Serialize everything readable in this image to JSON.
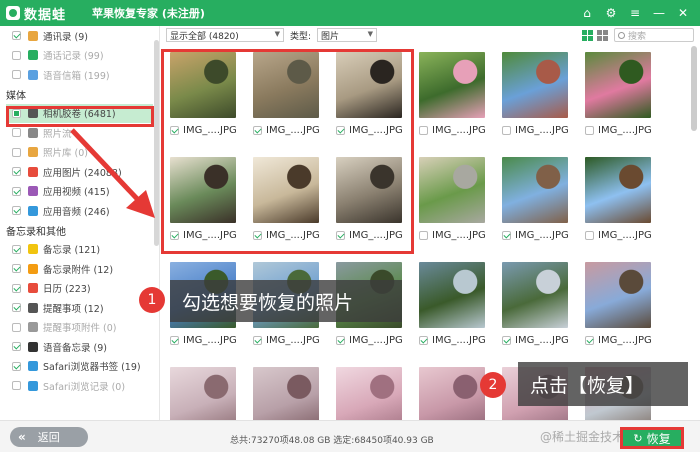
{
  "app": {
    "logo_text": "数据蛙",
    "title": "苹果恢复专家 (未注册)",
    "window_controls": [
      "home-icon",
      "gear-icon",
      "menu-icon",
      "minimize-icon",
      "close-icon"
    ]
  },
  "sidebar": {
    "top_items": [
      {
        "label": "通讯录 (9)",
        "checked": true,
        "icon_color": "#e8a640"
      },
      {
        "label": "通话记录 (99)",
        "checked": false,
        "icon_color": "#27ae60",
        "dim": true
      },
      {
        "label": "语音信箱 (199)",
        "checked": false,
        "icon_color": "#5aa0e0",
        "dim": true
      }
    ],
    "media_section": "媒体",
    "media_items": [
      {
        "label": "相机胶卷 (6481)",
        "checked": "partial",
        "icon_color": "#555",
        "selected": true
      },
      {
        "label": "照片流",
        "checked": false,
        "icon_color": "#888",
        "dim": true
      },
      {
        "label": "照片库 (0)",
        "checked": false,
        "icon_color": "#e8a640",
        "dim": true
      },
      {
        "label": "应用图片 (24088)",
        "checked": true,
        "icon_color": "#e74c3c"
      },
      {
        "label": "应用视频 (415)",
        "checked": true,
        "icon_color": "#9b59b6"
      },
      {
        "label": "应用音频 (246)",
        "checked": true,
        "icon_color": "#3498db"
      }
    ],
    "notes_section": "备忘录和其他",
    "notes_items": [
      {
        "label": "备忘录 (121)",
        "checked": true,
        "icon_color": "#f1c40f"
      },
      {
        "label": "备忘录附件 (12)",
        "checked": true,
        "icon_color": "#f39c12"
      },
      {
        "label": "日历 (223)",
        "checked": true,
        "icon_color": "#e74c3c"
      },
      {
        "label": "提醒事项 (12)",
        "checked": true,
        "icon_color": "#555"
      },
      {
        "label": "提醒事项附件 (0)",
        "checked": false,
        "icon_color": "#999",
        "dim": true
      },
      {
        "label": "语音备忘录 (9)",
        "checked": true,
        "icon_color": "#333"
      },
      {
        "label": "Safari浏览器书签 (19)",
        "checked": true,
        "icon_color": "#3498db"
      },
      {
        "label": "Safari浏览记录 (0)",
        "checked": false,
        "icon_color": "#3498db",
        "dim": true
      }
    ]
  },
  "toolbar": {
    "filter_value": "显示全部 (4820)",
    "type_label": "类型:",
    "type_value": "图片",
    "search_placeholder": "搜索"
  },
  "grid": {
    "caption": "IMG_....JPG",
    "rows": [
      [
        {
          "checked": true,
          "colors": [
            "#7a8a4a",
            "#c9a36a",
            "#3d4a2a"
          ]
        },
        {
          "checked": true,
          "colors": [
            "#8a7a5e",
            "#b8a68a",
            "#5d5a48"
          ]
        },
        {
          "checked": true,
          "colors": [
            "#a89a82",
            "#d8cdb8",
            "#2a2520"
          ]
        },
        {
          "checked": false,
          "colors": [
            "#3d6b2c",
            "#8ab35a",
            "#e7a0b8"
          ]
        },
        {
          "checked": false,
          "colors": [
            "#6aa0d8",
            "#4f8a3a",
            "#a85a48"
          ]
        },
        {
          "checked": false,
          "colors": [
            "#e07aa0",
            "#5a8a3c",
            "#2f5a20"
          ]
        }
      ],
      [
        {
          "checked": true,
          "colors": [
            "#6a8a5a",
            "#e8e0d0",
            "#3a3028"
          ]
        },
        {
          "checked": true,
          "colors": [
            "#c8b89a",
            "#f0e8d8",
            "#4a3a2a"
          ]
        },
        {
          "checked": true,
          "colors": [
            "#8a8070",
            "#d8d0c0",
            "#3a342c"
          ]
        },
        {
          "checked": false,
          "colors": [
            "#6a9a4a",
            "#d8d0b8",
            "#a8a8a0"
          ]
        },
        {
          "checked": true,
          "colors": [
            "#80b0e0",
            "#4a8a4a",
            "#806048"
          ]
        },
        {
          "checked": false,
          "colors": [
            "#8ec0f0",
            "#2d5a24",
            "#6a4a30"
          ]
        }
      ],
      [
        {
          "checked": true,
          "colors": [
            "#4a80c8",
            "#8ab0e0",
            "#3a5a2a"
          ]
        },
        {
          "checked": true,
          "colors": [
            "#70a0d0",
            "#b0c8d8",
            "#4a6a3a"
          ]
        },
        {
          "checked": true,
          "colors": [
            "#5a8a4a",
            "#8a9aa0",
            "#3a4a2a"
          ]
        },
        {
          "checked": true,
          "colors": [
            "#3a5a2a",
            "#6a8a9a",
            "#b8c8d0"
          ]
        },
        {
          "checked": true,
          "colors": [
            "#4a6a3a",
            "#7a9ab0",
            "#c8d0d8"
          ]
        },
        {
          "checked": true,
          "colors": [
            "#88aad8",
            "#c89aa0",
            "#5a4a3a"
          ]
        }
      ],
      [
        {
          "checked": false,
          "colors": [
            "#c8b0b8",
            "#e8d8dc",
            "#8a6a70"
          ]
        },
        {
          "checked": false,
          "colors": [
            "#b8a0a8",
            "#d8c8cc",
            "#7a5a60"
          ]
        },
        {
          "checked": false,
          "colors": [
            "#d8a8b8",
            "#f0d8e0",
            "#a07080"
          ]
        },
        {
          "checked": false,
          "colors": [
            "#c898a8",
            "#e8c8d0",
            "#8a6070"
          ]
        },
        {
          "checked": false,
          "colors": [
            "#d0a0b0",
            "#ead0d8",
            "#906878"
          ]
        },
        {
          "checked": false,
          "colors": [
            "#c0c8d0",
            "#e0a8b8",
            "#7a6a60"
          ]
        }
      ]
    ]
  },
  "annotations": {
    "step1_num": "1",
    "step1_text": "勾选想要恢复的照片",
    "step2_num": "2",
    "step2_text": "点击【恢复】"
  },
  "footer": {
    "back_label": "返回",
    "stats": "总共:73270项48.08 GB 选定:68450项40.93 GB",
    "watermark": "@稀土掘金技术社区",
    "recover_label": "恢复"
  },
  "colors": {
    "accent": "#27ae60",
    "highlight": "#e53935"
  }
}
